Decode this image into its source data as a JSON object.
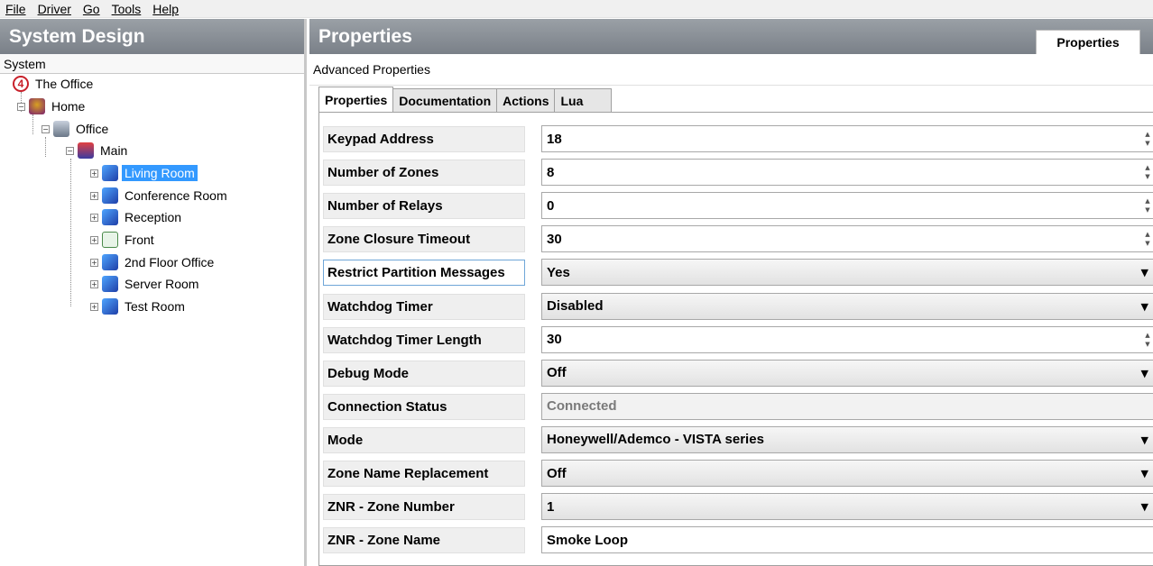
{
  "menu": [
    "File",
    "Driver",
    "Go",
    "Tools",
    "Help"
  ],
  "left": {
    "title": "System Design",
    "subheader": "System",
    "tree": [
      {
        "label": "The Office",
        "icon": "control4-logo-icon",
        "level": 0
      },
      {
        "label": "Home",
        "icon": "home-icon",
        "level": 1
      },
      {
        "label": "Office",
        "icon": "building-icon",
        "level": 2
      },
      {
        "label": "Main",
        "icon": "floor-icon",
        "level": 3
      },
      {
        "label": "Living Room",
        "icon": "room-icon",
        "level": 4,
        "selected": true
      },
      {
        "label": "Conference Room",
        "icon": "room-icon",
        "level": 4
      },
      {
        "label": "Reception",
        "icon": "room-icon",
        "level": 4
      },
      {
        "label": "Front",
        "icon": "window-icon",
        "level": 4
      },
      {
        "label": "2nd Floor Office",
        "icon": "room-icon",
        "level": 4
      },
      {
        "label": "Server Room",
        "icon": "room-icon",
        "level": 4
      },
      {
        "label": "Test Room",
        "icon": "room-icon",
        "level": 4
      }
    ]
  },
  "right": {
    "title": "Properties",
    "header_tab": "Properties",
    "subheader": "Advanced Properties",
    "tabs": [
      "Properties",
      "Documentation",
      "Actions",
      "Lua"
    ],
    "properties": [
      {
        "label": "Keypad Address",
        "value": "18",
        "kind": "spin"
      },
      {
        "label": "Number of Zones",
        "value": "8",
        "kind": "spin"
      },
      {
        "label": "Number of Relays",
        "value": "0",
        "kind": "spin"
      },
      {
        "label": "Zone Closure Timeout",
        "value": "30",
        "kind": "spin"
      },
      {
        "label": "Restrict Partition Messages",
        "value": "Yes",
        "kind": "combo"
      },
      {
        "label": "Watchdog Timer",
        "value": "Disabled",
        "kind": "combo"
      },
      {
        "label": "Watchdog Timer Length",
        "value": "30",
        "kind": "spin"
      },
      {
        "label": "Debug Mode",
        "value": "Off",
        "kind": "combo"
      },
      {
        "label": "Connection Status",
        "value": "Connected",
        "kind": "readonly"
      },
      {
        "label": "Mode",
        "value": "Honeywell/Ademco - VISTA series",
        "kind": "combo"
      },
      {
        "label": "Zone Name Replacement",
        "value": "Off",
        "kind": "combo"
      },
      {
        "label": "ZNR - Zone Number",
        "value": "1",
        "kind": "combo"
      },
      {
        "label": "ZNR - Zone Name",
        "value": "Smoke Loop",
        "kind": "text"
      }
    ]
  },
  "colors": {
    "header_bg": "#8a9096",
    "selection": "#3399ff",
    "accent_red": "#c8202a"
  }
}
